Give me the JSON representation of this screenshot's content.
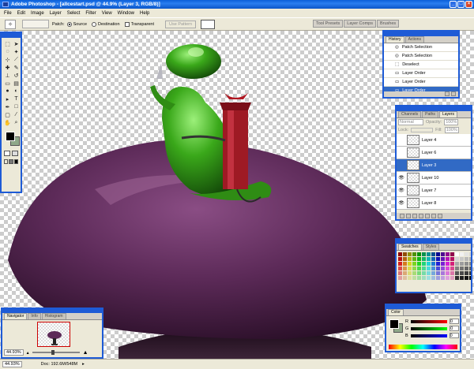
{
  "window": {
    "title": "Adobe Photoshop - [allcestart.psd @ 44.9% (Layer 3, RGB/8)]",
    "buttons": [
      "_",
      "□",
      "×"
    ]
  },
  "menu": [
    "File",
    "Edit",
    "Image",
    "Layer",
    "Select",
    "Filter",
    "View",
    "Window",
    "Help"
  ],
  "options": {
    "patch_label": "Patch:",
    "source": "Source",
    "destination": "Destination",
    "transparent": "Transparent",
    "use_pattern": "Use Pattern",
    "wells": [
      "Tool Presets",
      "Layer Comps",
      "Brushes"
    ]
  },
  "history": {
    "tabs": [
      "History",
      "Actions"
    ],
    "items": [
      "Patch Selection",
      "Patch Selection",
      "Deselect",
      "Layer Order",
      "Layer Order",
      "Layer Order"
    ],
    "selected": 5
  },
  "layers": {
    "tabs": [
      "Channels",
      "Paths",
      "Layers"
    ],
    "blend": "Normal",
    "opacity_label": "Opacity:",
    "opacity": "100%",
    "lock_label": "Lock:",
    "fill_label": "Fill:",
    "fill": "100%",
    "items": [
      {
        "name": "Layer 4",
        "visible": false
      },
      {
        "name": "Layer 6",
        "visible": false
      },
      {
        "name": "Layer 3",
        "visible": false,
        "selected": true
      },
      {
        "name": "Layer 10",
        "visible": true
      },
      {
        "name": "Layer 7",
        "visible": true
      },
      {
        "name": "Layer 8",
        "visible": true
      }
    ]
  },
  "swatches": {
    "tabs": [
      "Swatches",
      "Styles"
    ]
  },
  "navigator": {
    "tabs": [
      "Navigator",
      "Info",
      "Histogram"
    ],
    "zoom": "44.93%"
  },
  "color": {
    "tabs": [
      "Color"
    ],
    "channels": [
      {
        "label": "R",
        "value": "0"
      },
      {
        "label": "G",
        "value": "0"
      },
      {
        "label": "B",
        "value": "0"
      }
    ]
  },
  "status": {
    "zoom": "44.93%",
    "doc": "Doc: 192.6M/548M"
  },
  "colors": {
    "xp_blue": "#1e5bd6",
    "panel": "#ece9d8",
    "selection": "#316ac5",
    "mushroom": "#5c2a58",
    "frog": "#39b01a"
  }
}
